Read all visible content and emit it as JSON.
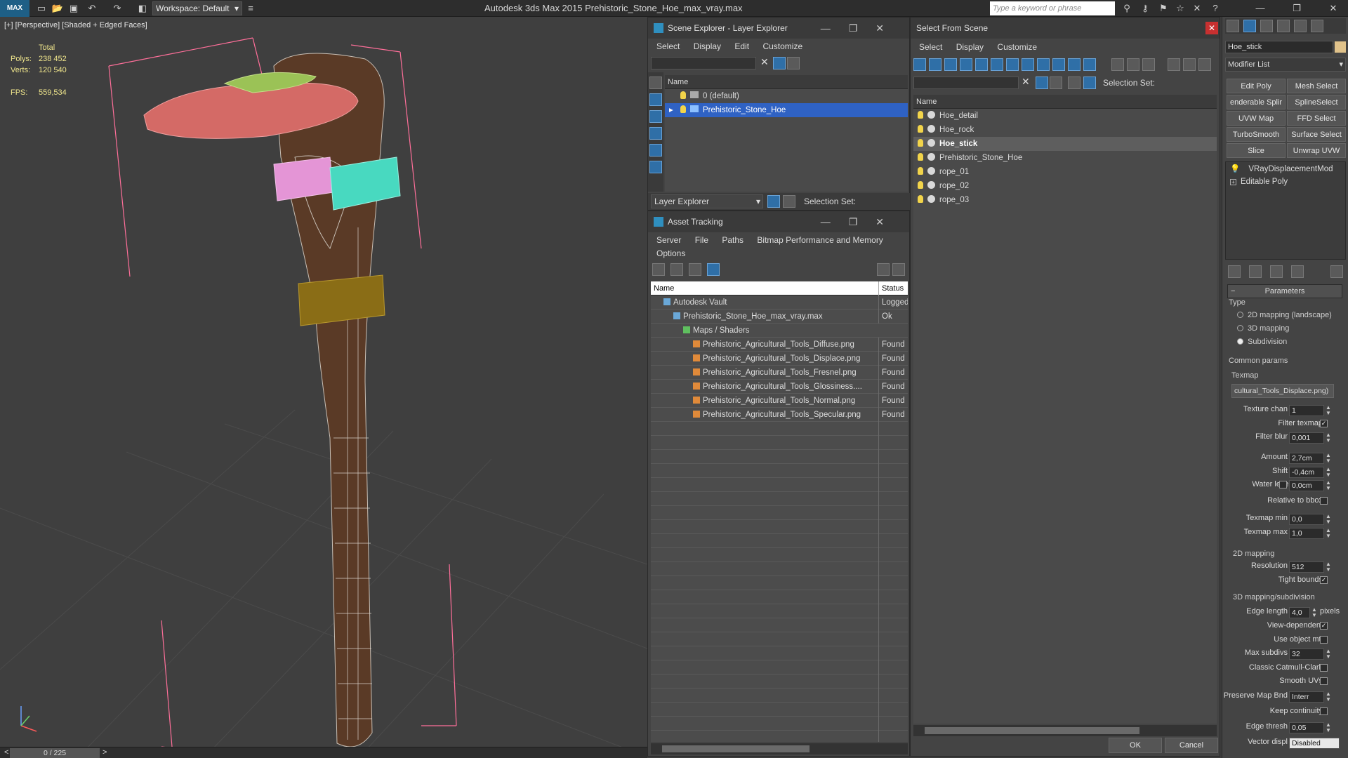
{
  "app": {
    "title": "Autodesk 3ds Max  2015     Prehistoric_Stone_Hoe_max_vray.max",
    "logo": "MAX",
    "workspace": "Workspace: Default",
    "search_placeholder": "Type a keyword or phrase"
  },
  "viewport": {
    "label": "[+] [Perspective] [Shaded + Edged Faces]",
    "stats_total": "Total",
    "polys_label": "Polys:",
    "polys_value": "238 452",
    "verts_label": "Verts:",
    "verts_value": "120 540",
    "fps_label": "FPS:",
    "fps_value": "559,534",
    "timeline": "0 / 225",
    "timeline_prev": "<",
    "timeline_next": ">"
  },
  "scene_explorer": {
    "title": "Scene Explorer - Layer Explorer",
    "menus": [
      "Select",
      "Display",
      "Edit",
      "Customize"
    ],
    "column": "Name",
    "rows": [
      "0 (default)",
      "Prehistoric_Stone_Hoe"
    ],
    "footer_dropdown": "Layer Explorer",
    "selection_set": "Selection Set:"
  },
  "asset_tracking": {
    "title": "Asset Tracking",
    "menus": [
      "Server",
      "File",
      "Paths",
      "Bitmap Performance and Memory"
    ],
    "menu2": "Options",
    "col_name": "Name",
    "col_status": "Status",
    "rows": [
      {
        "name": "Autodesk Vault",
        "status": "Logged",
        "indent": 0
      },
      {
        "name": "Prehistoric_Stone_Hoe_max_vray.max",
        "status": "Ok",
        "indent": 1
      },
      {
        "name": "Maps / Shaders",
        "status": "",
        "indent": 2
      },
      {
        "name": "Prehistoric_Agricultural_Tools_Diffuse.png",
        "status": "Found",
        "indent": 3
      },
      {
        "name": "Prehistoric_Agricultural_Tools_Displace.png",
        "status": "Found",
        "indent": 3
      },
      {
        "name": "Prehistoric_Agricultural_Tools_Fresnel.png",
        "status": "Found",
        "indent": 3
      },
      {
        "name": "Prehistoric_Agricultural_Tools_Glossiness....",
        "status": "Found",
        "indent": 3
      },
      {
        "name": "Prehistoric_Agricultural_Tools_Normal.png",
        "status": "Found",
        "indent": 3
      },
      {
        "name": "Prehistoric_Agricultural_Tools_Specular.png",
        "status": "Found",
        "indent": 3
      }
    ]
  },
  "select_from_scene": {
    "title": "Select From Scene",
    "menus": [
      "Select",
      "Display",
      "Customize"
    ],
    "selection_set": "Selection Set:",
    "column": "Name",
    "rows": [
      "Hoe_detail",
      "Hoe_rock",
      "Hoe_stick",
      "Prehistoric_Stone_Hoe",
      "rope_01",
      "rope_02",
      "rope_03"
    ],
    "selected": "Hoe_stick",
    "ok": "OK",
    "cancel": "Cancel"
  },
  "command_panel": {
    "object_name": "Hoe_stick",
    "modifier_list": "Modifier List",
    "buttons": [
      "Edit Poly",
      "Mesh Select",
      "enderable Splir",
      "SplineSelect",
      "UVW Map",
      "FFD Select",
      "TurboSmooth",
      "Surface Select",
      "Slice",
      "Unwrap UVW"
    ],
    "stack": [
      "VRayDisplacementMod",
      "Editable Poly"
    ],
    "rollout": "Parameters",
    "type_label": "Type",
    "types": [
      "2D mapping (landscape)",
      "3D mapping",
      "Subdivision"
    ],
    "common_params": "Common params",
    "texmap_label": "Texmap",
    "texmap_value": "cultural_Tools_Displace.png)",
    "texture_chan_label": "Texture chan",
    "texture_chan": "1",
    "filter_texmap": "Filter texmap",
    "filter_blur_label": "Filter blur",
    "filter_blur": "0,001",
    "amount_label": "Amount",
    "amount": "2,7cm",
    "shift_label": "Shift",
    "shift": "-0,4cm",
    "water_level_label": "Water level",
    "water_level": "0,0cm",
    "relative_bbox": "Relative to bbox",
    "texmap_min_label": "Texmap min",
    "texmap_min": "0,0",
    "texmap_max_label": "Texmap max",
    "texmap_max": "1,0",
    "mapping2d": "2D mapping",
    "resolution_label": "Resolution",
    "resolution": "512",
    "tight_bounds": "Tight bounds",
    "mapping3d": "3D mapping/subdivision",
    "edge_length_label": "Edge length",
    "edge_length": "4,0",
    "pixels": "pixels",
    "view_dependent": "View-dependent",
    "use_object_mtl": "Use object mtl",
    "max_subdivs_label": "Max subdivs",
    "max_subdivs": "32",
    "classic_catmull": "Classic Catmull-Clark",
    "smooth_uvs": "Smooth UVs",
    "preserve_map_label": "Preserve Map Bnd",
    "preserve_map": "Interr",
    "keep_continuity": "Keep continuity",
    "edge_thresh_label": "Edge thresh",
    "edge_thresh": "0,05",
    "vector_displ_label": "Vector displ",
    "vector_displ": "Disabled"
  }
}
